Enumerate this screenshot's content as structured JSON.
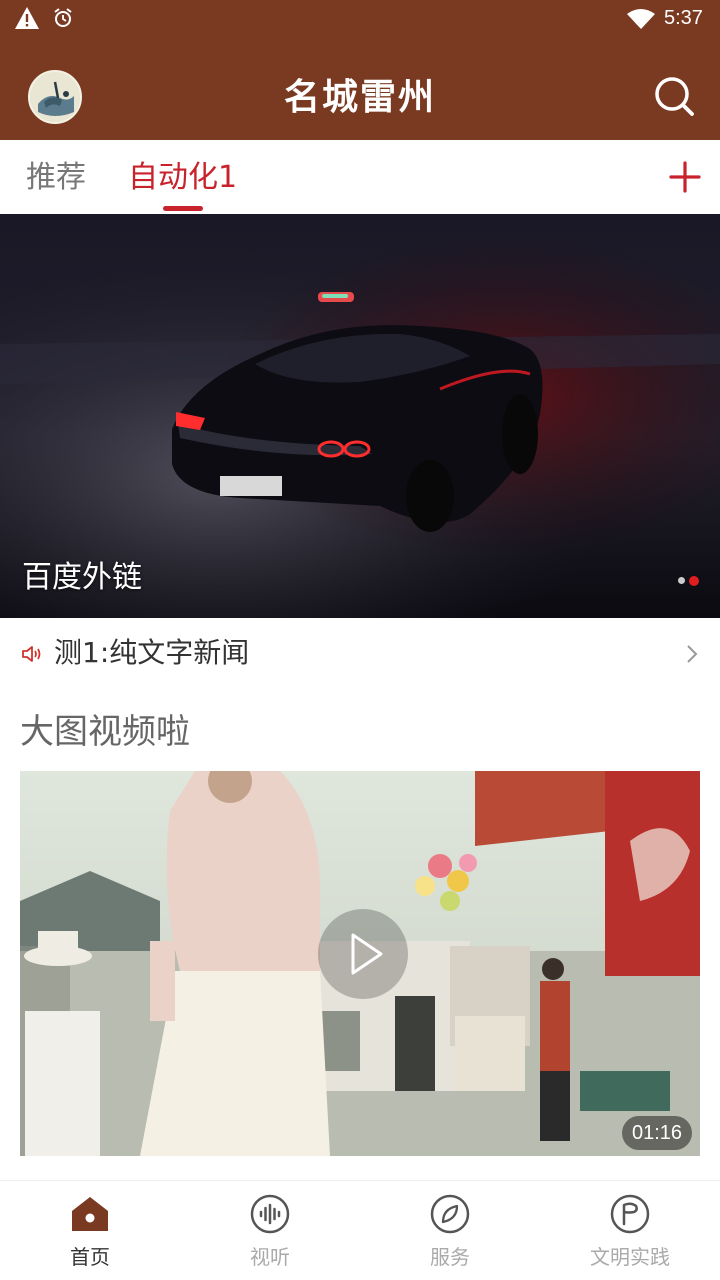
{
  "status_bar": {
    "time": "5:37",
    "icons": [
      "warning-icon",
      "alarm-icon",
      "wifi-icon"
    ]
  },
  "header": {
    "title": "名城雷州",
    "avatar_icon": "app-logo-avatar",
    "search_icon": "search-icon",
    "background_color": "#7a3a22"
  },
  "tabs": {
    "items": [
      {
        "label": "推荐",
        "active": false
      },
      {
        "label": "自动化1",
        "active": true
      }
    ],
    "add_icon": "plus-icon",
    "active_color": "#c8232c"
  },
  "banner": {
    "caption": "百度外链",
    "slide_count": 2,
    "active_slide": 2
  },
  "notice": {
    "icon": "speaker-icon",
    "text": "测1:纯文字新闻"
  },
  "section": {
    "title": "大图视频啦"
  },
  "video": {
    "duration": "01:16",
    "play_icon": "play-icon"
  },
  "bottom_nav": {
    "items": [
      {
        "label": "首页",
        "icon": "home-icon",
        "active": true
      },
      {
        "label": "视听",
        "icon": "audio-wave-icon",
        "active": false
      },
      {
        "label": "服务",
        "icon": "compass-icon",
        "active": false
      },
      {
        "label": "文明实践",
        "icon": "flag-circle-icon",
        "active": false
      }
    ]
  }
}
